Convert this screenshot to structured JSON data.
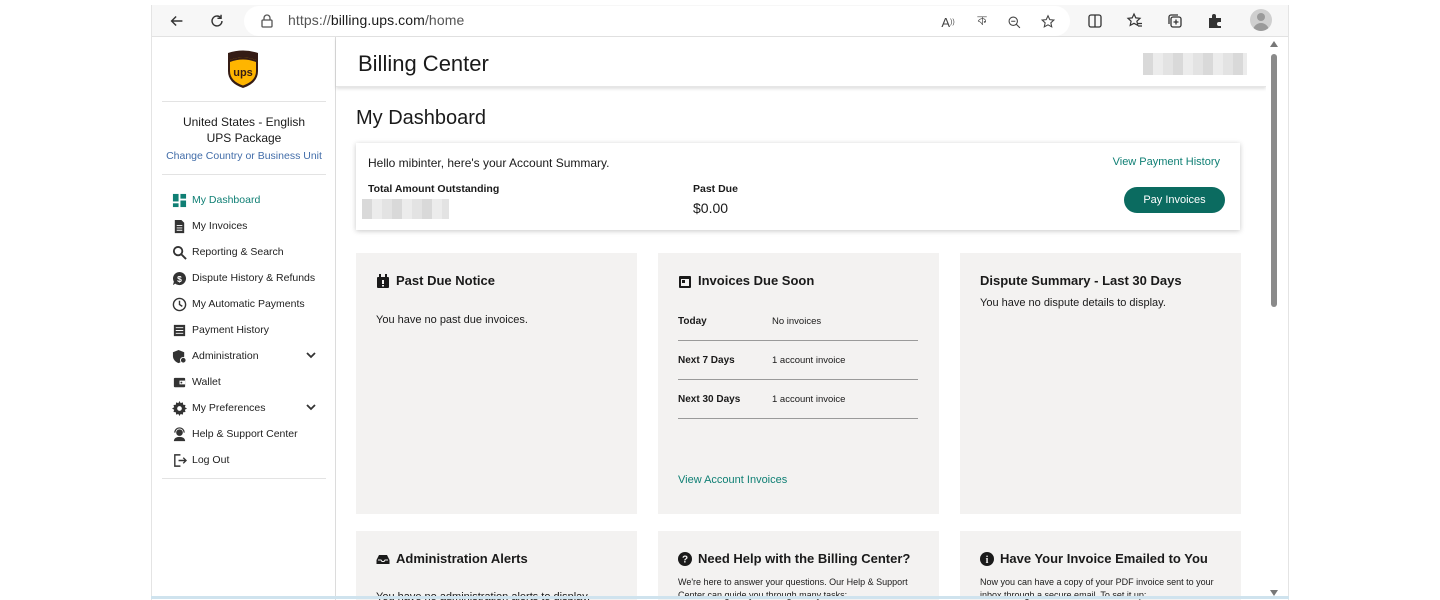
{
  "browser": {
    "url_prefix": "https://",
    "url_host": "billing.ups.com",
    "url_path": "/home"
  },
  "sidebar": {
    "country": "United States - English",
    "business_unit": "UPS Package",
    "change_link": "Change Country or Business Unit",
    "items": [
      {
        "label": "My Dashboard",
        "icon": "dashboard-icon"
      },
      {
        "label": "My Invoices",
        "icon": "document-icon"
      },
      {
        "label": "Reporting & Search",
        "icon": "search-icon"
      },
      {
        "label": "Dispute History & Refunds",
        "icon": "dispute-icon"
      },
      {
        "label": "My Automatic Payments",
        "icon": "clock-icon"
      },
      {
        "label": "Payment History",
        "icon": "list-icon"
      },
      {
        "label": "Administration",
        "icon": "admin-shield-icon"
      },
      {
        "label": "Wallet",
        "icon": "wallet-icon"
      },
      {
        "label": "My Preferences",
        "icon": "gear-icon"
      },
      {
        "label": "Help & Support Center",
        "icon": "support-agent-icon"
      },
      {
        "label": "Log Out",
        "icon": "logout-icon"
      }
    ]
  },
  "header": {
    "title": "Billing Center"
  },
  "dashboard": {
    "title": "My Dashboard",
    "summary": {
      "greeting": "Hello mibinter, here's your Account Summary.",
      "payment_history_link": "View Payment History",
      "total_label": "Total Amount Outstanding",
      "past_due_label": "Past Due",
      "past_due_value": "$0.00",
      "pay_button": "Pay Invoices"
    },
    "cards": {
      "past_due": {
        "title": "Past Due Notice",
        "text": "You have no past due invoices."
      },
      "due_soon": {
        "title": "Invoices Due Soon",
        "rows": [
          {
            "label": "Today",
            "value": "No invoices"
          },
          {
            "label": "Next 7 Days",
            "value": "1 account invoice"
          },
          {
            "label": "Next 30 Days",
            "value": "1 account invoice"
          }
        ],
        "link": "View Account Invoices"
      },
      "dispute": {
        "title": "Dispute Summary - Last 30 Days",
        "text": "You have no dispute details to display."
      },
      "admin_alerts": {
        "title": "Administration Alerts",
        "text": "You have no administration alerts to display."
      },
      "help": {
        "title": "Need Help with the Billing Center?",
        "text": "We're here to answer your questions. Our Help & Support Center can guide you through many tasks:"
      },
      "email": {
        "title": "Have Your Invoice Emailed to You",
        "text": "Now you can have a copy of your PDF invoice sent to your inbox through a secure email. To set it up:"
      }
    }
  },
  "colors": {
    "accent": "#0f7f74",
    "button": "#0b6b60",
    "card_bg": "#f3f2f1",
    "link_blue": "#426da9"
  }
}
